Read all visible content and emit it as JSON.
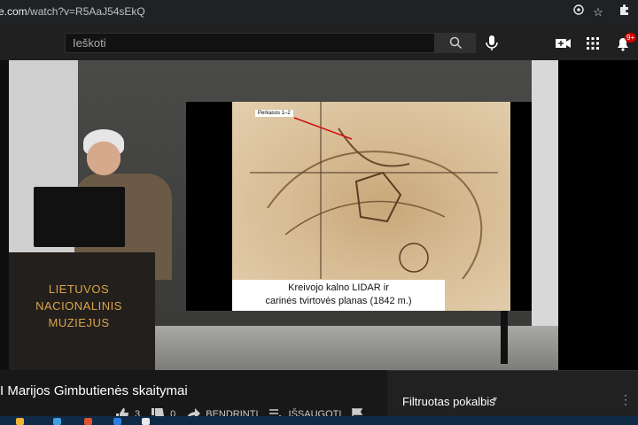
{
  "browser": {
    "url_prefix": "e.com",
    "url_rest": "/watch?v=R5AaJ54sEkQ",
    "icons": [
      "install-icon",
      "star-icon",
      "extensions-icon"
    ]
  },
  "masthead": {
    "search_placeholder": "Ieškoti",
    "notifications_badge": "9+",
    "icons": [
      "search-icon",
      "mic-icon",
      "create-video-icon",
      "apps-icon",
      "bell-icon"
    ]
  },
  "video": {
    "podium_text": [
      "LIETUVOS",
      "NACIONALINIS",
      "MUZIEJUS"
    ],
    "slide_label": "Perkasos 1–2",
    "slide_caption_line1": "Kreivojo kalno LIDAR ir",
    "slide_caption_line2": "carinės tvirtovės planas (1842 m.)"
  },
  "below": {
    "title": "I Marijos Gimbutienės skaitymai",
    "likes": "3",
    "dislikes": "0",
    "share_label": "BENDRINTI",
    "save_label": "IŠSAUGOTI"
  },
  "chat": {
    "title": "Filtruotas pokalbis"
  },
  "colors": {
    "accent_red": "#cc0000",
    "podium_gold": "#d9a54a"
  }
}
